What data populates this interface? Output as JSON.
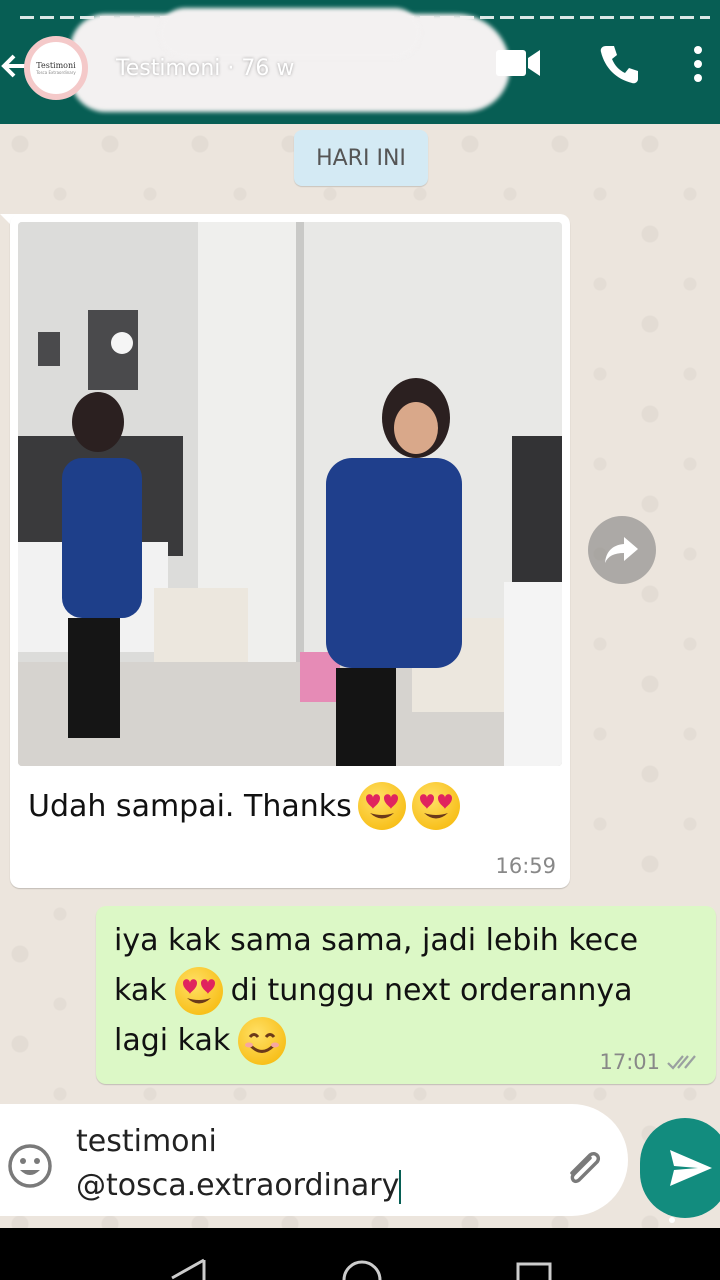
{
  "header": {
    "chat_title": "Testimoni · 76 w",
    "avatar_brand": "Testimoni",
    "avatar_sub": "Tosca Extraordinary",
    "color": "#075e54"
  },
  "date_chip": "HARI INI",
  "incoming": {
    "text": "Udah sampai. Thanks",
    "emojis": [
      "heart-eyes-emoji",
      "heart-eyes-emoji"
    ],
    "time": "16:59"
  },
  "outgoing": {
    "line1": "iya kak sama sama, jadi lebih kece",
    "line2a": "kak",
    "line2b": "di tunggu next orderannya",
    "line3": "lagi kak",
    "time": "17:01",
    "status": "read"
  },
  "composer": {
    "line1": "testimoni",
    "line2": "@tosca.extraordinary",
    "accent": "#128c7e"
  },
  "colors": {
    "outgoing_bubble": "#dcf8c6",
    "incoming_bubble": "#ffffff",
    "date_chip": "#d4eaf4"
  }
}
